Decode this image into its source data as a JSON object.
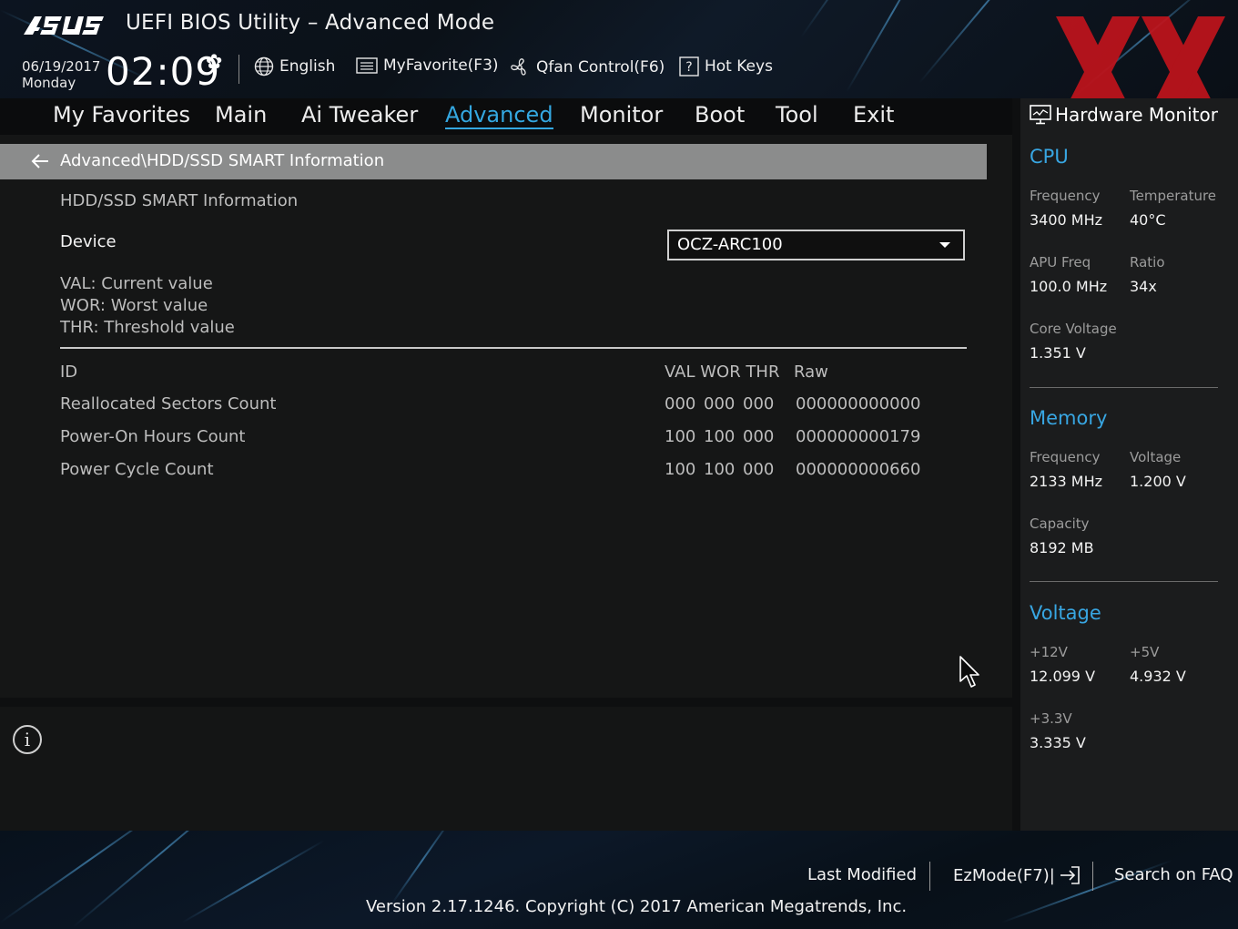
{
  "header": {
    "app_title": "UEFI BIOS Utility – Advanced Mode",
    "date": "06/19/2017",
    "day": "Monday",
    "time": "02:09",
    "tools": {
      "language": "English",
      "favorite": "MyFavorite(F3)",
      "qfan": "Qfan Control(F6)",
      "hotkeys": "Hot Keys"
    }
  },
  "tabs": [
    "My Favorites",
    "Main",
    "Ai Tweaker",
    "Advanced",
    "Monitor",
    "Boot",
    "Tool",
    "Exit"
  ],
  "active_tab": "Advanced",
  "breadcrumb": "Advanced\\HDD/SSD SMART Information",
  "section_title": "HDD/SSD SMART Information",
  "device": {
    "label": "Device",
    "selected": "OCZ-ARC100"
  },
  "legend": [
    "VAL:  Current value",
    "WOR: Worst value",
    "THR:  Threshold value"
  ],
  "table": {
    "headers": {
      "id": "ID",
      "vwt": "VAL WOR THR",
      "raw": "Raw"
    },
    "rows": [
      {
        "name": "Reallocated Sectors Count",
        "val": "000",
        "wor": "000",
        "thr": "000",
        "raw": "000000000000"
      },
      {
        "name": "Power-On Hours Count",
        "val": "100",
        "wor": "100",
        "thr": "000",
        "raw": "000000000179"
      },
      {
        "name": "Power Cycle Count",
        "val": "100",
        "wor": "100",
        "thr": "000",
        "raw": "000000000660"
      }
    ]
  },
  "hardware_monitor": {
    "title": "Hardware Monitor",
    "cpu": {
      "title": "CPU",
      "frequency_label": "Frequency",
      "frequency": "3400 MHz",
      "temperature_label": "Temperature",
      "temperature": "40°C",
      "apu_label": "APU Freq",
      "apu": "100.0 MHz",
      "ratio_label": "Ratio",
      "ratio": "34x",
      "core_voltage_label": "Core Voltage",
      "core_voltage": "1.351 V"
    },
    "memory": {
      "title": "Memory",
      "frequency_label": "Frequency",
      "frequency": "2133 MHz",
      "voltage_label": "Voltage",
      "voltage": "1.200 V",
      "capacity_label": "Capacity",
      "capacity": "8192 MB"
    },
    "voltage": {
      "title": "Voltage",
      "v12_label": "+12V",
      "v12": "12.099 V",
      "v5_label": "+5V",
      "v5": "4.932 V",
      "v33_label": "+3.3V",
      "v33": "3.335 V"
    }
  },
  "footer": {
    "last_modified": "Last Modified",
    "ezmode": "EzMode(F7)|",
    "search": "Search on FAQ",
    "version": "Version 2.17.1246. Copyright (C) 2017 American Megatrends, Inc."
  },
  "colors": {
    "accent": "#34a7e0",
    "watermark": "#c0141c"
  }
}
